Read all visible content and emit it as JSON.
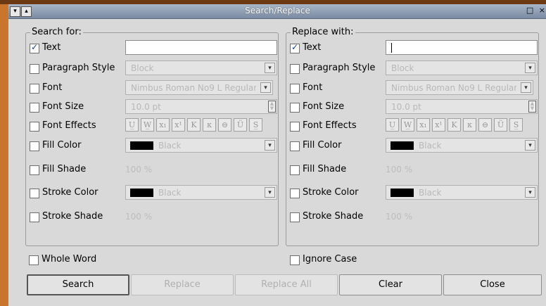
{
  "window": {
    "title": "Search/Replace",
    "title_buttons": "□ ×"
  },
  "search": {
    "group_title": "Search for:",
    "rows": {
      "text": {
        "label": "Text",
        "checked": true,
        "value": ""
      },
      "paragraph_style": {
        "label": "Paragraph Style",
        "checked": false,
        "value": "Block"
      },
      "font": {
        "label": "Font",
        "checked": false,
        "value": "Nimbus Roman No9 L Regular"
      },
      "font_size": {
        "label": "Font Size",
        "checked": false,
        "value": "10.0 pt"
      },
      "font_effects": {
        "label": "Font Effects",
        "checked": false
      },
      "fill_color": {
        "label": "Fill Color",
        "checked": false,
        "value": "Black"
      },
      "fill_shade": {
        "label": "Fill Shade",
        "checked": false,
        "value": "100 %"
      },
      "stroke_color": {
        "label": "Stroke Color",
        "checked": false,
        "value": "Black"
      },
      "stroke_shade": {
        "label": "Stroke Shade",
        "checked": false,
        "value": "100 %"
      }
    }
  },
  "replace": {
    "group_title": "Replace with:",
    "rows": {
      "text": {
        "label": "Text",
        "checked": true,
        "value": ""
      },
      "paragraph_style": {
        "label": "Paragraph Style",
        "checked": false,
        "value": "Block"
      },
      "font": {
        "label": "Font",
        "checked": false,
        "value": "Nimbus Roman No9 L Regular"
      },
      "font_size": {
        "label": "Font Size",
        "checked": false,
        "value": "10.0 pt"
      },
      "font_effects": {
        "label": "Font Effects",
        "checked": false
      },
      "fill_color": {
        "label": "Fill Color",
        "checked": false,
        "value": "Black"
      },
      "fill_shade": {
        "label": "Fill Shade",
        "checked": false,
        "value": "100 %"
      },
      "stroke_color": {
        "label": "Stroke Color",
        "checked": false,
        "value": "Black"
      },
      "stroke_shade": {
        "label": "Stroke Shade",
        "checked": false,
        "value": "100 %"
      }
    }
  },
  "effects_icons": [
    "U̲",
    "W̲",
    "x₁",
    "x¹",
    "K",
    "ᴋ",
    "⊖",
    "Ü",
    "S̲"
  ],
  "options": {
    "whole_word": "Whole Word",
    "ignore_case": "Ignore Case"
  },
  "buttons": {
    "search": "Search",
    "replace": "Replace",
    "replace_all": "Replace All",
    "clear": "Clear",
    "close": "Close"
  },
  "colors": {
    "swatch": "#000000",
    "titlebar": "#8e9db3",
    "accent_strip": "#c9752b"
  }
}
